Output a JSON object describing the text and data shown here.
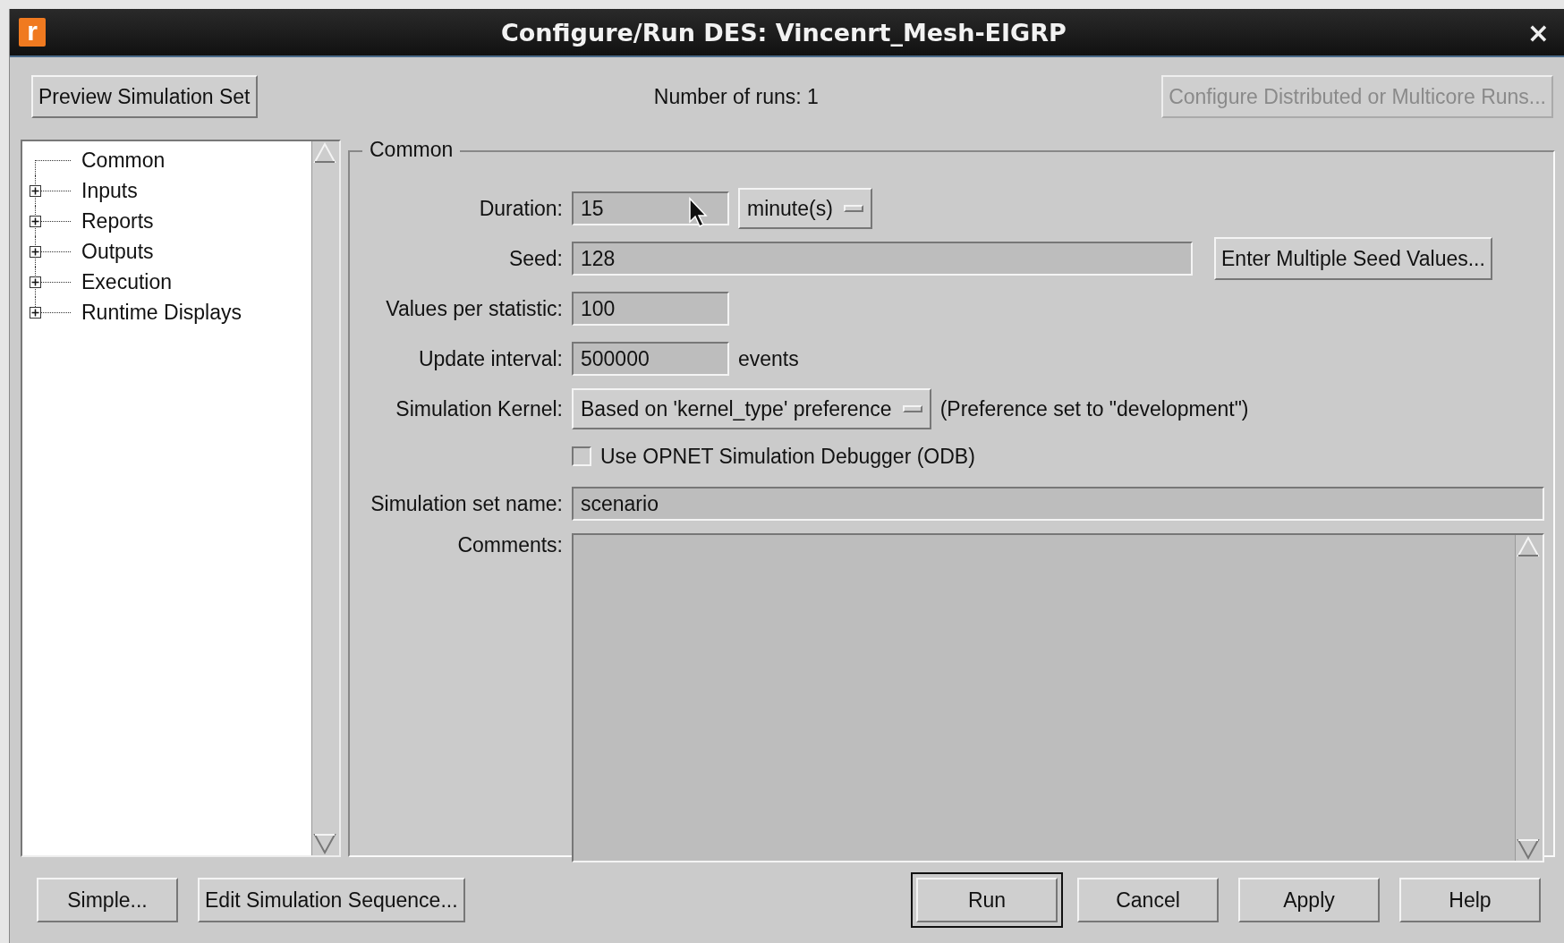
{
  "window": {
    "app_icon": "r",
    "title": "Configure/Run DES: Vincenrt_Mesh-EIGRP",
    "close": "×"
  },
  "toolbar": {
    "preview_button": "Preview Simulation Set",
    "runs_label": "Number of runs: 1",
    "distributed_button": {
      "label": "Configure Distributed or Multicore Runs...",
      "disabled": true
    }
  },
  "tree": {
    "items": [
      {
        "label": "Common",
        "expandable": false
      },
      {
        "label": "Inputs",
        "expandable": true
      },
      {
        "label": "Reports",
        "expandable": true
      },
      {
        "label": "Outputs",
        "expandable": true
      },
      {
        "label": "Execution",
        "expandable": true
      },
      {
        "label": "Runtime Displays",
        "expandable": true
      }
    ]
  },
  "group": {
    "title": "Common",
    "fields": [
      {
        "kind": "short",
        "label": "Duration:",
        "value": "15",
        "unit": "minute(s)"
      },
      {
        "kind": "long",
        "label": "Seed:",
        "value": "128",
        "button": "Enter Multiple Seed Values..."
      },
      {
        "kind": "short",
        "label": "Values per statistic:",
        "value": "100"
      },
      {
        "kind": "short",
        "label": "Update interval:",
        "value": "500000",
        "suffix": "events"
      },
      {
        "kind": "select",
        "label": "Simulation Kernel:",
        "value": "Based on 'kernel_type' preference",
        "note": "(Preference set to \"development\")"
      },
      {
        "kind": "checkbox",
        "label": "Use OPNET Simulation Debugger (ODB)",
        "checked": false
      },
      {
        "kind": "full",
        "label": "Simulation set name:",
        "value": "scenario"
      },
      {
        "kind": "textarea",
        "label": "Comments:"
      }
    ]
  },
  "bottom": {
    "left_buttons": [
      {
        "label": "Simple...",
        "default": false
      },
      {
        "label": "Edit Simulation Sequence...",
        "default": false
      }
    ],
    "right_buttons": [
      {
        "label": "Run",
        "default": true
      },
      {
        "label": "Cancel",
        "default": false
      },
      {
        "label": "Apply",
        "default": false
      },
      {
        "label": "Help",
        "default": false
      }
    ]
  }
}
